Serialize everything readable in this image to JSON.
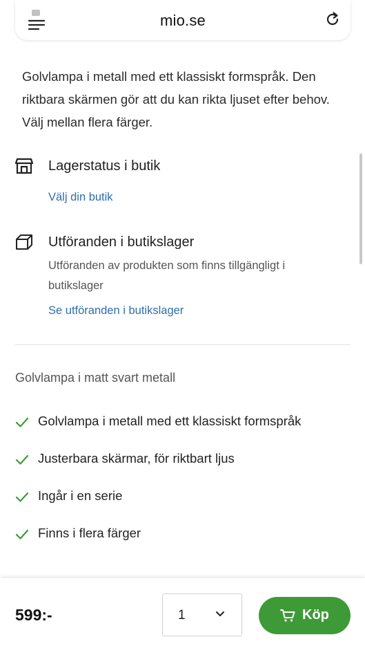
{
  "browser": {
    "url": "mio.se",
    "menu_icon": "menu-icon",
    "reload_icon": "reload-icon"
  },
  "product": {
    "description": "Golvlampa i metall med ett klassiskt formspråk. Den riktbara skärmen gör att du kan rikta ljuset efter behov. Välj mellan flera färger."
  },
  "store_stock": {
    "icon": "store-icon",
    "heading": "Lagerstatus i butik",
    "link": "Välj din butik"
  },
  "variants_stock": {
    "icon": "box-icon",
    "heading": "Utföranden i butikslager",
    "description": "Utföranden av produkten som finns tillgängligt i butikslager",
    "link": "Se utföranden i butikslager"
  },
  "summary": "Golvlampa i matt svart metall",
  "features": [
    "Golvlampa i metall med ett klassiskt formspråk",
    "Justerbara skärmar, för riktbart ljus",
    "Ingår i en serie",
    "Finns i flera färger"
  ],
  "purchase": {
    "price": "599:-",
    "quantity": "1",
    "buy_label": "Köp"
  },
  "colors": {
    "accent_green": "#3e9a37",
    "link_blue": "#2f6ea8"
  }
}
